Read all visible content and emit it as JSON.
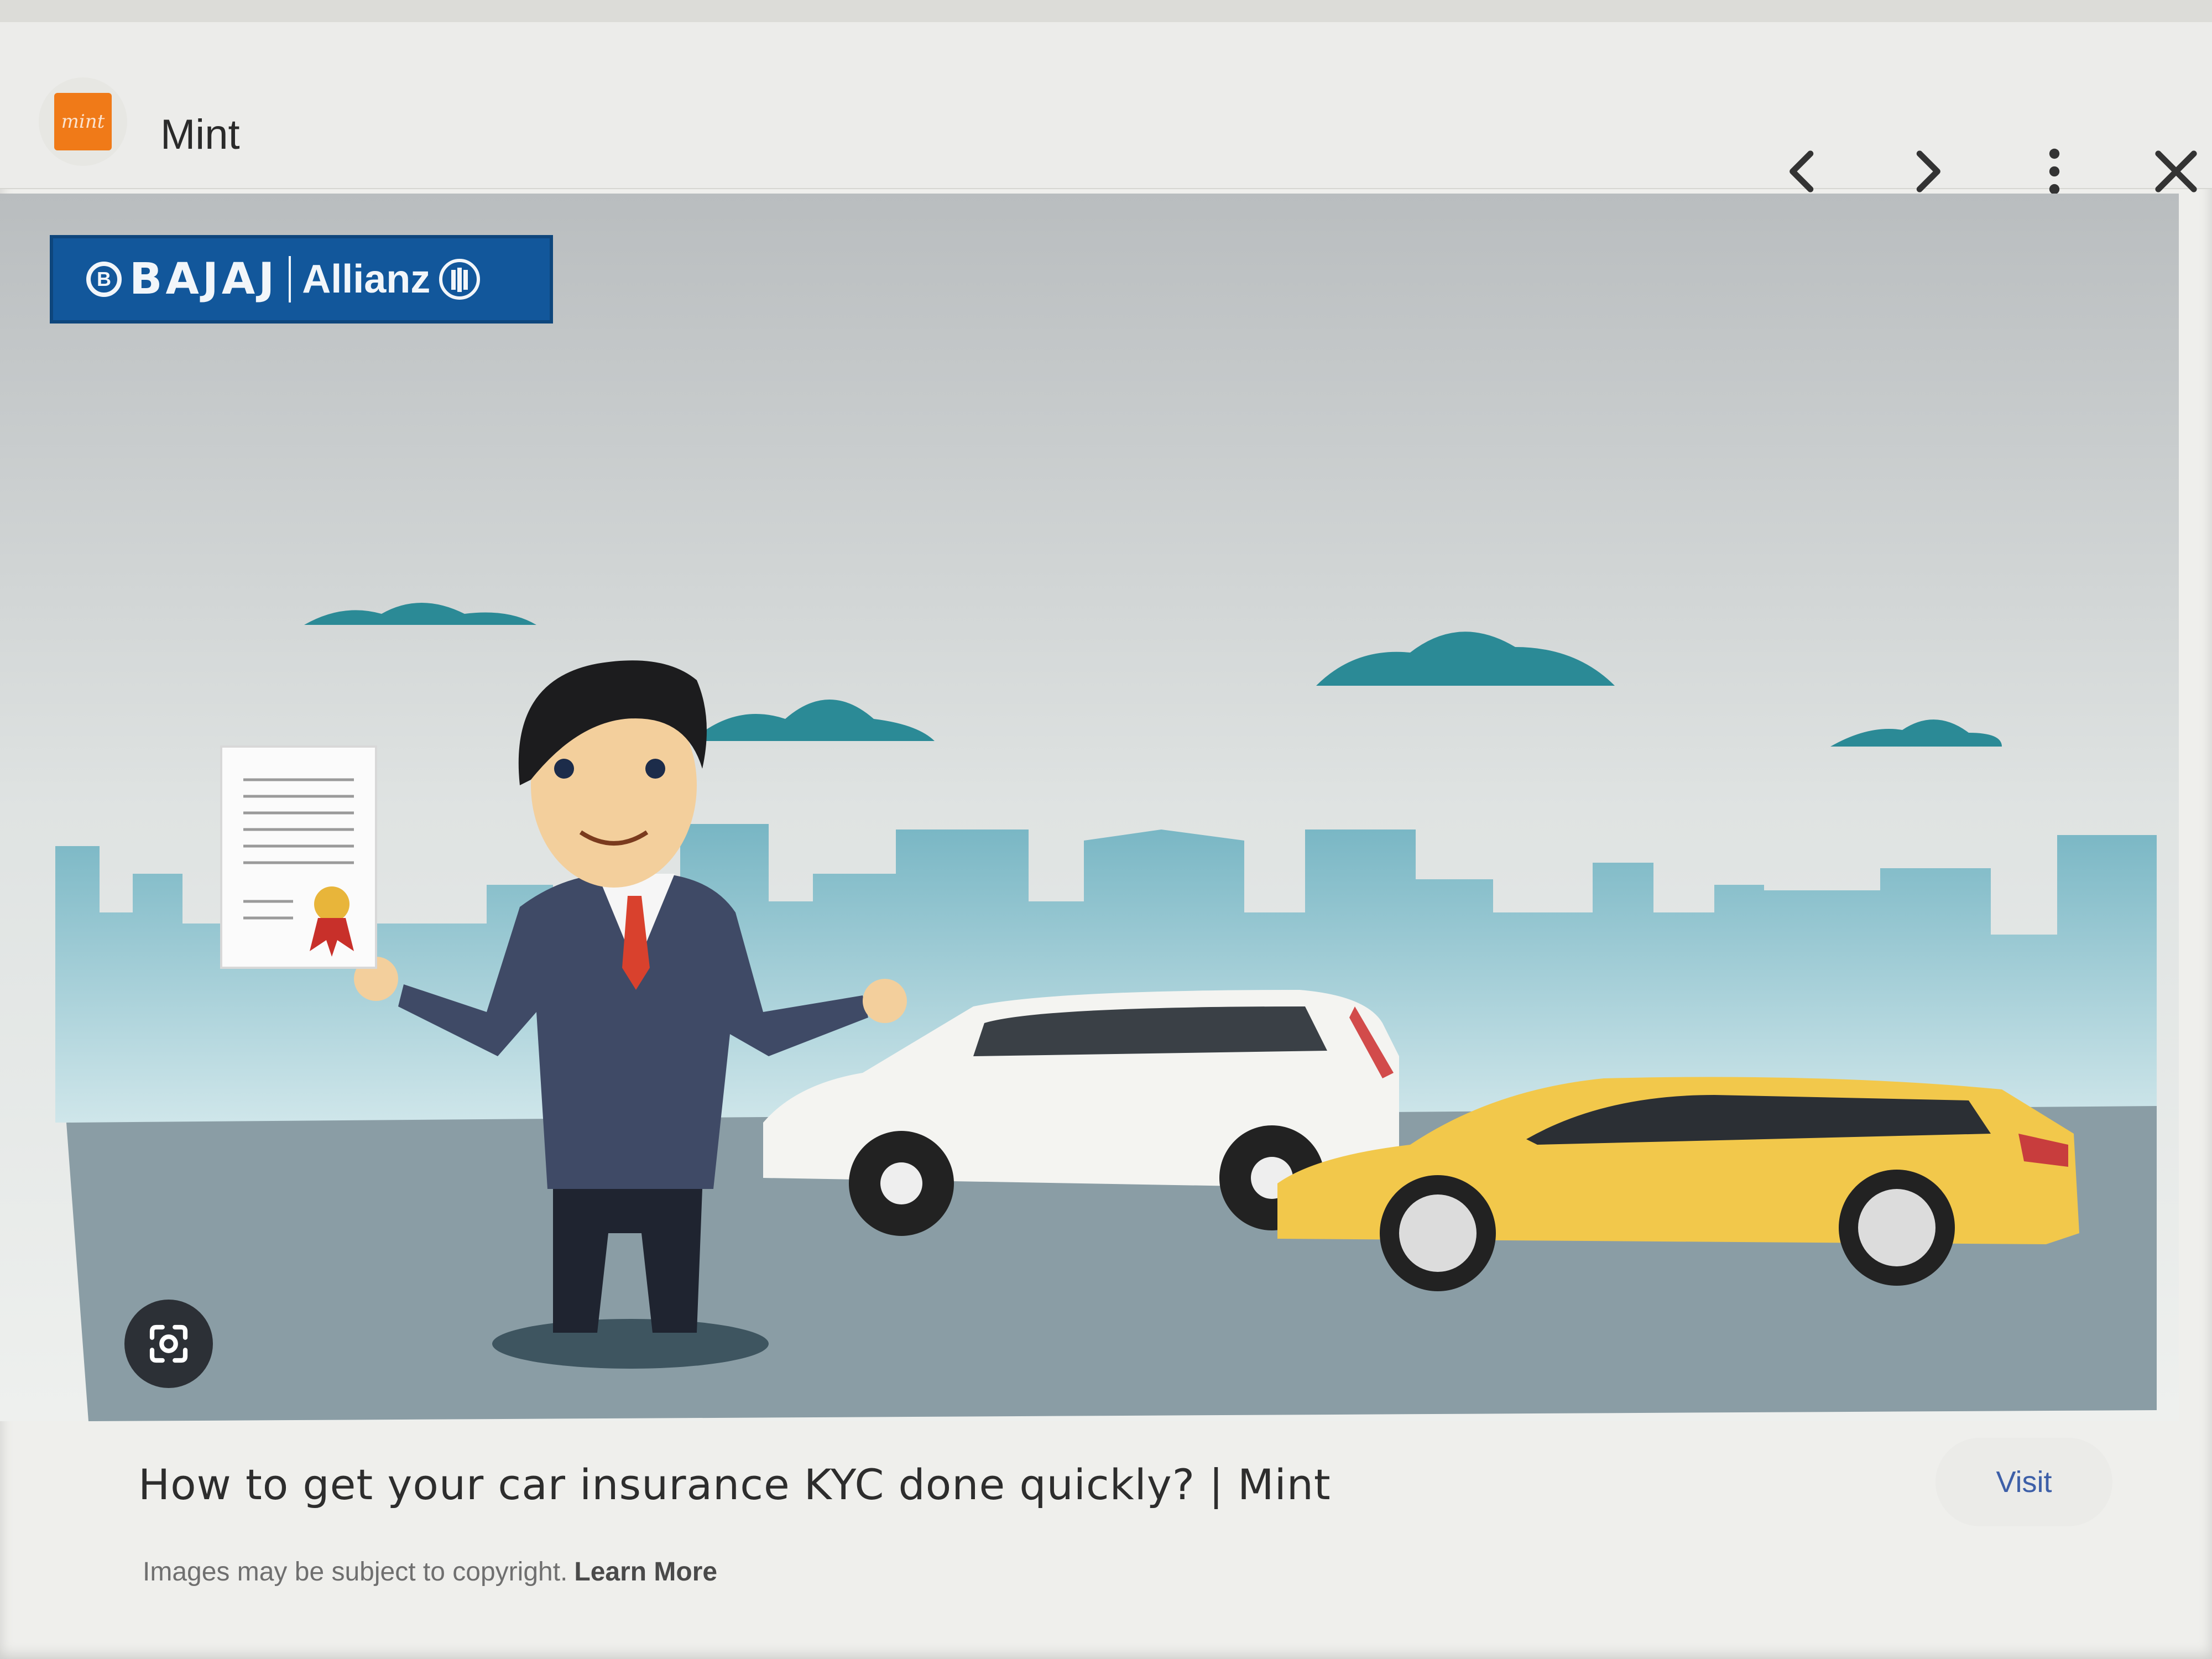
{
  "header": {
    "favicon_text": "mint",
    "site_title": "Mint",
    "icons": [
      "chevron-left-icon",
      "chevron-right-icon",
      "more-vert-icon",
      "close-icon"
    ]
  },
  "image": {
    "logo": {
      "brand_left": "BAJAJ",
      "brand_right": "Allianz",
      "badge": "B"
    },
    "lens_icon": "visual-search-icon"
  },
  "caption": {
    "title": "How to get your car insurance KYC done quickly? | Mint",
    "copyright_text": "Images may be subject to copyright.",
    "learn_more": "Learn More",
    "visit": "Visit"
  },
  "colors": {
    "logo_blue": "#12579b",
    "accent_orange": "#f07a18",
    "visit_link": "#3d5fa8",
    "sky_cloud": "#2b8a96"
  }
}
